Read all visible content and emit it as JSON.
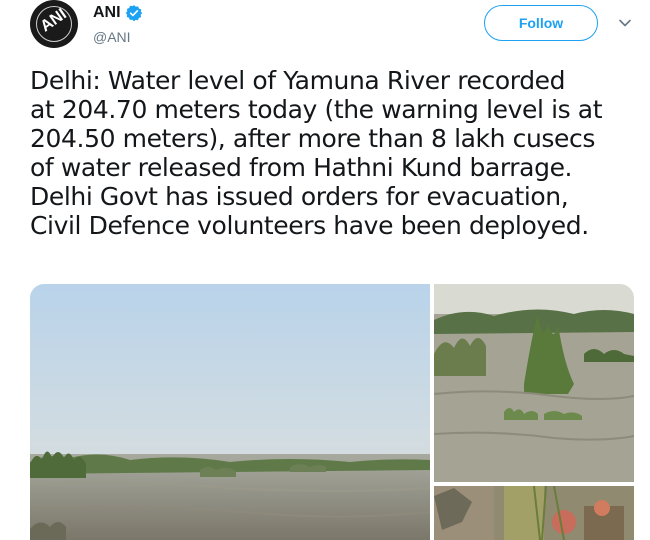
{
  "tweet": {
    "author": {
      "avatar_label": "ANI",
      "display_name": "ANI",
      "handle": "@ANI",
      "verified": true
    },
    "follow_label": "Follow",
    "text_lines": [
      "Delhi: Water level of Yamuna River recorded",
      "at 204.70 meters today (the warning level is at",
      "204.50 meters), after more than 8 lakh cusecs",
      "of water released from Hathni Kund barrage.",
      "Delhi Govt has issued orders for evacuation,",
      "Civil Defence volunteers have been deployed."
    ],
    "media": [
      {
        "name": "flooded river wide view"
      },
      {
        "name": "submerged shrubs in river"
      },
      {
        "name": "people near the riverbank"
      }
    ]
  },
  "colors": {
    "accent": "#1da1f2",
    "text": "#14171a",
    "muted": "#657786"
  },
  "icons": {
    "verified": "verified-badge-icon",
    "caret": "chevron-down-icon"
  }
}
